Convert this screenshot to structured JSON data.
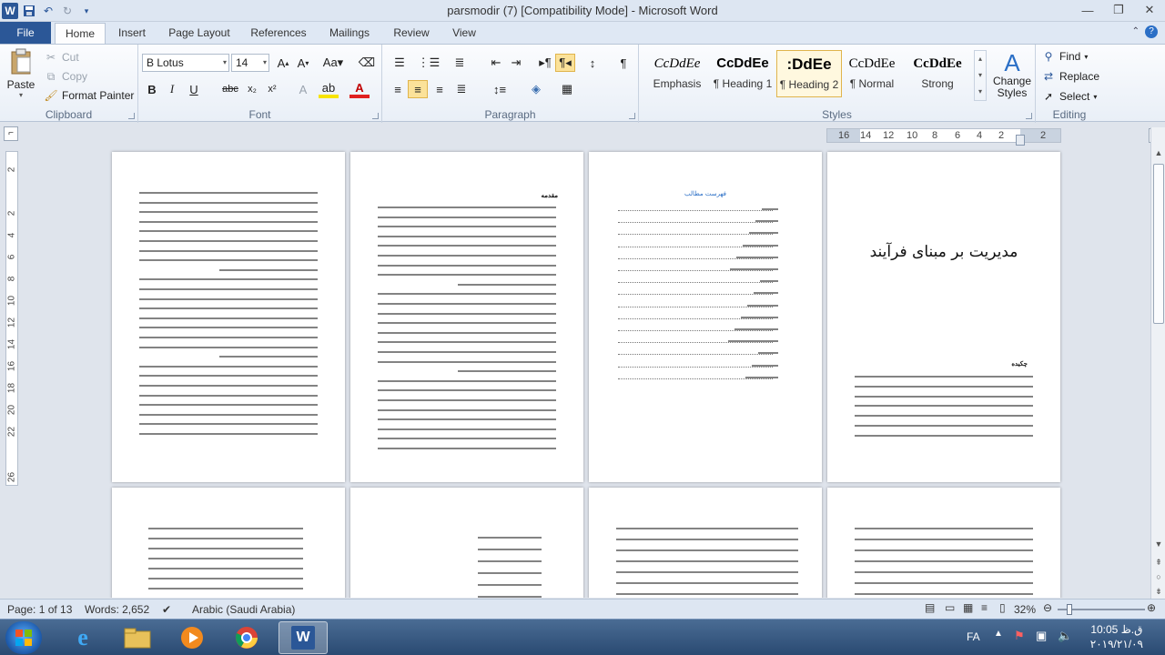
{
  "window": {
    "title": "parsmodir (7) [Compatibility Mode]  -  Microsoft Word"
  },
  "qat": {
    "save_icon": "save-icon",
    "undo_icon": "undo-icon",
    "redo_icon": "redo-icon"
  },
  "tabs": [
    "File",
    "Home",
    "Insert",
    "Page Layout",
    "References",
    "Mailings",
    "Review",
    "View"
  ],
  "clipboard": {
    "paste": "Paste",
    "cut": "Cut",
    "copy": "Copy",
    "format_painter": "Format Painter",
    "label": "Clipboard"
  },
  "font": {
    "name": "B Lotus",
    "size": "14",
    "label": "Font"
  },
  "paragraph": {
    "label": "Paragraph"
  },
  "styles": {
    "items": [
      {
        "preview": "CcDdEe",
        "name": "Emphasis"
      },
      {
        "preview": "CcDdEe",
        "name": "¶ Heading 1"
      },
      {
        "preview": ":DdEe",
        "name": "¶ Heading 2"
      },
      {
        "preview": "CcDdEe",
        "name": "¶ Normal"
      },
      {
        "preview": "CcDdEe",
        "name": "Strong"
      }
    ],
    "change_styles": "Change Styles",
    "label": "Styles"
  },
  "editing": {
    "find": "Find",
    "replace": "Replace",
    "select": "Select",
    "label": "Editing"
  },
  "ruler": {
    "numbers": [
      "16",
      "14",
      "12",
      "10",
      "8",
      "6",
      "4",
      "2",
      "2"
    ]
  },
  "vruler": {
    "numbers": [
      "2",
      "2",
      "4",
      "6",
      "8",
      "10",
      "12",
      "14",
      "16",
      "18",
      "20",
      "22",
      "26"
    ]
  },
  "document": {
    "cover_title": "مدیریت بر مبنای فرآیند",
    "cover_section": "چکیده",
    "toc_title": "فهرست مطالب",
    "intro_heading": "مقدمه"
  },
  "status": {
    "page": "Page: 1 of 13",
    "words": "Words: 2,652",
    "language": "Arabic (Saudi Arabia)",
    "zoom": "32%"
  },
  "tray": {
    "lang": "FA",
    "time": "10:05 ق.ظ",
    "date": "۲۰۱۹/۲۱/۰۹"
  }
}
